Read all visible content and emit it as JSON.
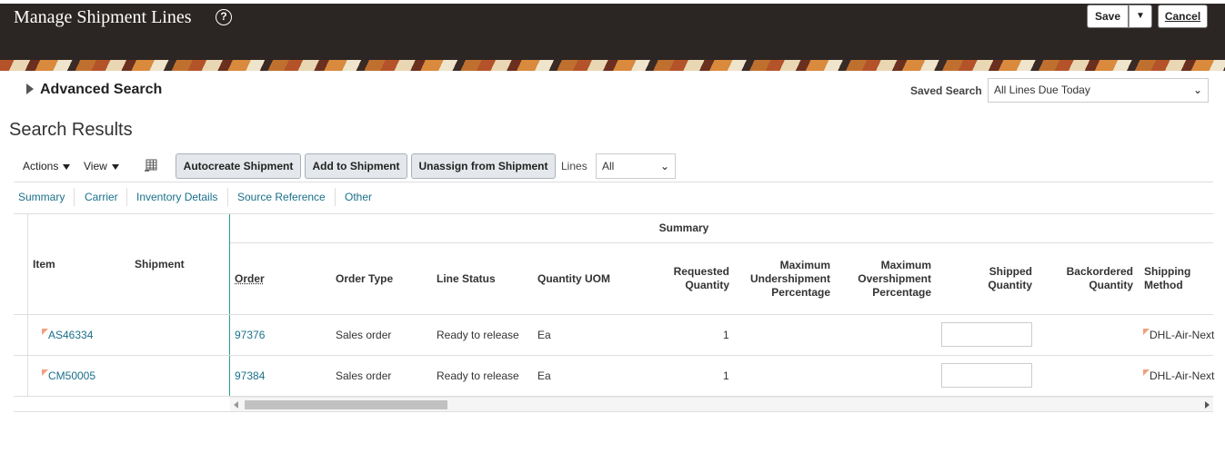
{
  "header": {
    "title": "Manage Shipment Lines",
    "save_label": "Save",
    "save_drop_label": "▼",
    "cancel_label": "Cancel"
  },
  "search": {
    "advanced_label": "Advanced Search",
    "saved_search_label": "Saved Search",
    "saved_search_value": "All Lines Due Today"
  },
  "results": {
    "title": "Search Results",
    "actions_label": "Actions",
    "view_label": "View",
    "autocreate_label": "Autocreate Shipment",
    "add_label": "Add to Shipment",
    "unassign_label": "Unassign from Shipment",
    "lines_label": "Lines",
    "lines_value": "All"
  },
  "tabs": [
    {
      "label": "Summary"
    },
    {
      "label": "Carrier"
    },
    {
      "label": "Inventory Details"
    },
    {
      "label": "Source Reference"
    },
    {
      "label": "Other"
    }
  ],
  "table": {
    "group_header": "Summary",
    "columns": {
      "item": "Item",
      "shipment": "Shipment",
      "order": "Order",
      "order_type": "Order Type",
      "line_status": "Line Status",
      "quantity_uom": "Quantity UOM",
      "requested_quantity": "Requested Quantity",
      "max_under": "Maximum Undershipment Percentage",
      "max_over": "Maximum Overshipment Percentage",
      "shipped_quantity": "Shipped Quantity",
      "backordered_quantity": "Backordered Quantity",
      "shipping_method": "Shipping Method"
    },
    "rows": [
      {
        "item": "AS46334",
        "shipment": "",
        "order": "97376",
        "order_type": "Sales order",
        "line_status": "Ready to release",
        "uom": "Ea",
        "requested": "1",
        "shipping_method": "DHL-Air-Next"
      },
      {
        "item": "CM50005",
        "shipment": "",
        "order": "97384",
        "order_type": "Sales order",
        "line_status": "Ready to release",
        "uom": "Ea",
        "requested": "1",
        "shipping_method": "DHL-Air-Next"
      }
    ]
  },
  "colors": {
    "header_bg": "#2b2523",
    "link": "#1a6f8b",
    "frozen_separator": "#2a9d8f",
    "button_bg": "#e4e8ec"
  }
}
